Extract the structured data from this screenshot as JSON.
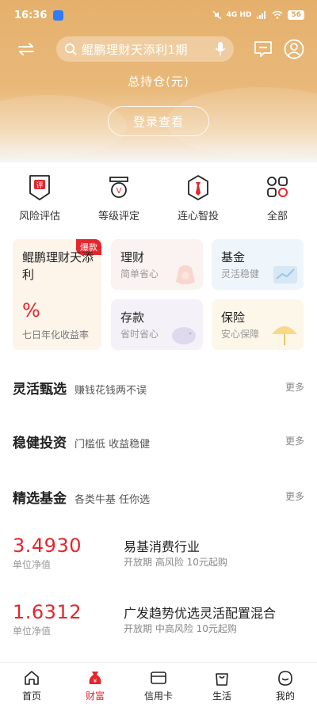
{
  "status_bar": {
    "time": "16:36",
    "network": "4G HD",
    "battery": "56"
  },
  "search": {
    "query": "鲲鹏理财天添利1期"
  },
  "header": {
    "hold_title": "总持仓(元)",
    "login_label": "登录查看"
  },
  "quick_actions": [
    {
      "label": "风险评估",
      "icon": "risk-assessment-icon"
    },
    {
      "label": "等级评定",
      "icon": "level-rating-icon"
    },
    {
      "label": "连心智投",
      "icon": "smart-invest-icon"
    },
    {
      "label": "全部",
      "icon": "all-apps-icon"
    }
  ],
  "featured": {
    "title": "鲲鹏理财天添利",
    "badge": "爆款",
    "rate": "%",
    "rate_label": "七日年化收益率"
  },
  "categories": [
    {
      "title": "理财",
      "subtitle": "简单省心"
    },
    {
      "title": "基金",
      "subtitle": "灵活稳健"
    },
    {
      "title": "存款",
      "subtitle": "省时省心"
    },
    {
      "title": "保险",
      "subtitle": "安心保障"
    }
  ],
  "sections": [
    {
      "title": "灵活甄选",
      "desc": "赚钱花钱两不误",
      "more": "更多"
    },
    {
      "title": "稳健投资",
      "desc": "门槛低 收益稳健",
      "more": "更多"
    },
    {
      "title": "精选基金",
      "desc": "各类牛基 任你选",
      "more": "更多"
    }
  ],
  "funds": [
    {
      "nav": "3.4930",
      "nav_label": "单位净值",
      "name": "易基消费行业",
      "tags": "开放期  高风险  10元起购"
    },
    {
      "nav": "1.6312",
      "nav_label": "单位净值",
      "name": "广发趋势优选灵活配置混合",
      "tags": "开放期  中高风险  10元起购"
    }
  ],
  "tabs": [
    {
      "label": "首页",
      "icon": "home-icon"
    },
    {
      "label": "财富",
      "icon": "wealth-icon"
    },
    {
      "label": "信用卡",
      "icon": "credit-card-icon"
    },
    {
      "label": "生活",
      "icon": "shopping-bag-icon"
    },
    {
      "label": "我的",
      "icon": "profile-icon"
    }
  ],
  "colors": {
    "header": "#e5b06c",
    "accent": "#e4262d"
  }
}
